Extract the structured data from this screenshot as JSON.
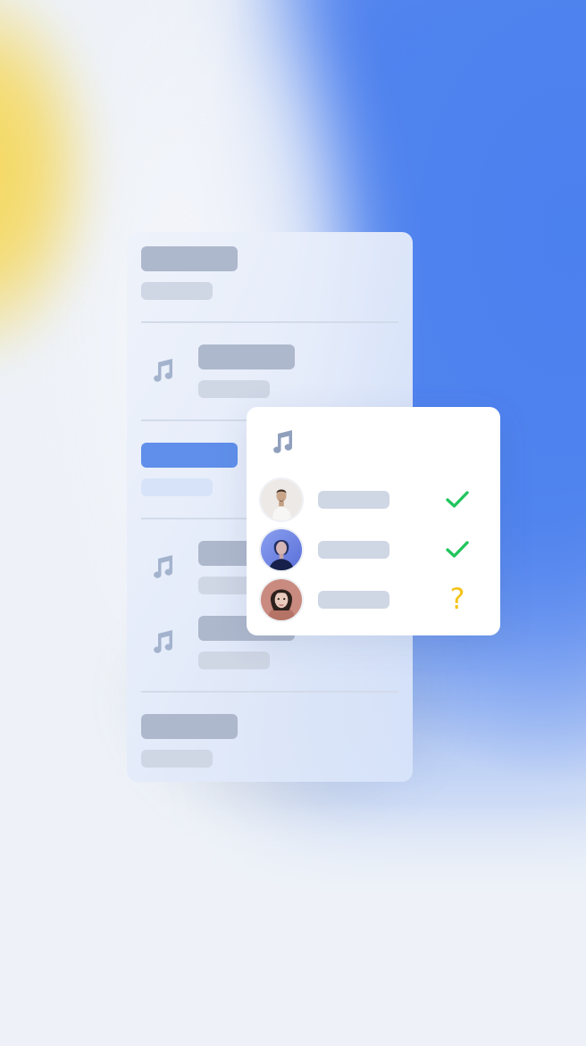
{
  "colors": {
    "accent": "#5f8fea",
    "placeholder_dark": "#aeb8cc",
    "placeholder_light": "#cfd6e4",
    "icon": "#8f9fbc",
    "check": "#22c55e",
    "pending": "#f5c31c"
  },
  "list": {
    "sections": [
      {
        "type": "header-placeholder"
      },
      {
        "type": "item",
        "icon": "music-note-icon"
      },
      {
        "type": "item-selected"
      },
      {
        "type": "item",
        "icon": "music-note-icon"
      },
      {
        "type": "item",
        "icon": "music-note-icon"
      },
      {
        "type": "footer-placeholder"
      }
    ]
  },
  "popup": {
    "icon": "music-note-icon",
    "participants": [
      {
        "avatar": "avatar-man-white-shirt",
        "status": "confirmed",
        "status_icon": "check-icon"
      },
      {
        "avatar": "avatar-woman-blue-light",
        "status": "confirmed",
        "status_icon": "check-icon"
      },
      {
        "avatar": "avatar-woman-dark-hair",
        "status": "pending",
        "status_text": "?"
      }
    ]
  }
}
